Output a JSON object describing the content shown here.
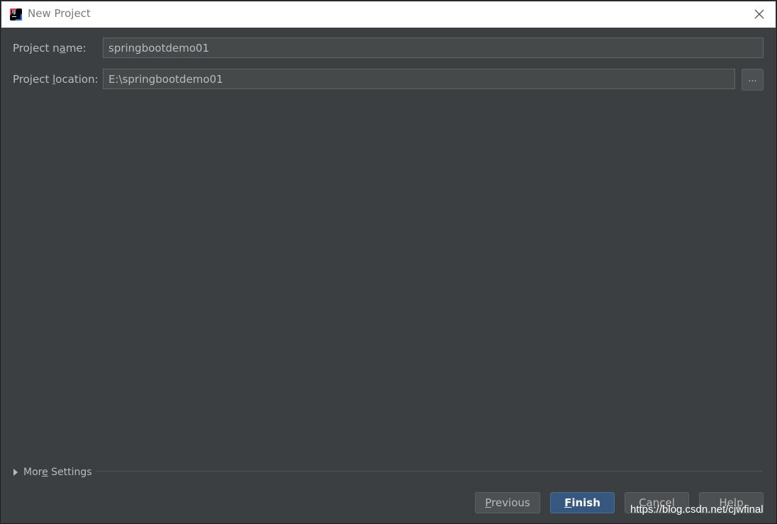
{
  "window": {
    "title": "New Project",
    "icon": "intellij-idea-icon"
  },
  "form": {
    "project_name": {
      "label_prefix": "Project n",
      "label_mnemonic": "a",
      "label_suffix": "me:",
      "value": "springbootdemo01"
    },
    "project_location": {
      "label_prefix": "Project ",
      "label_mnemonic": "l",
      "label_suffix": "ocation:",
      "value": "E:\\springbootdemo01",
      "browse_label": "..."
    }
  },
  "more_settings": {
    "prefix": "Mor",
    "mnemonic": "e",
    "suffix": " Settings"
  },
  "buttons": {
    "previous": {
      "mnemonic": "P",
      "rest": "revious"
    },
    "finish": {
      "mnemonic": "F",
      "rest": "inish"
    },
    "cancel": {
      "label": "Cancel"
    },
    "help": {
      "label": "Help"
    }
  },
  "watermark": "https://blog.csdn.net/cjwfinal",
  "colors": {
    "background": "#3c3f41",
    "field_background": "#45494a",
    "primary_button": "#365880",
    "text": "#bbbbbb"
  }
}
